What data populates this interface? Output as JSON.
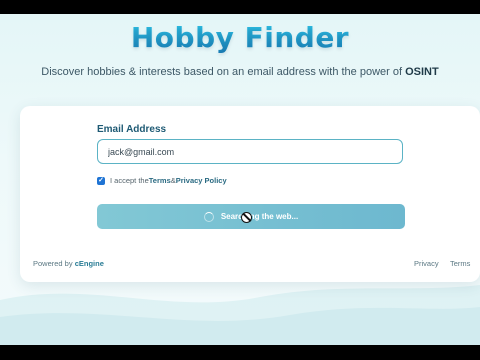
{
  "header": {
    "title": "Hobby Finder",
    "subtitle_prefix": "Discover hobbies & interests based on an email address with the power of ",
    "subtitle_bold": "OSINT"
  },
  "form": {
    "email_label": "Email Address",
    "email_value": "jack@gmail.com",
    "consent_prefix": "I accept the ",
    "terms_link": "Terms",
    "consent_and": " & ",
    "privacy_link": "Privacy Policy",
    "consent_checked": true,
    "search_button_label": "Searching the web..."
  },
  "footer": {
    "powered_prefix": "Powered by ",
    "powered_brand": "cEngine",
    "privacy_link": "Privacy",
    "terms_link": "Terms"
  },
  "colors": {
    "accent": "#1f8bc0",
    "button": "#6db8cf",
    "checkbox": "#1f74d4"
  }
}
